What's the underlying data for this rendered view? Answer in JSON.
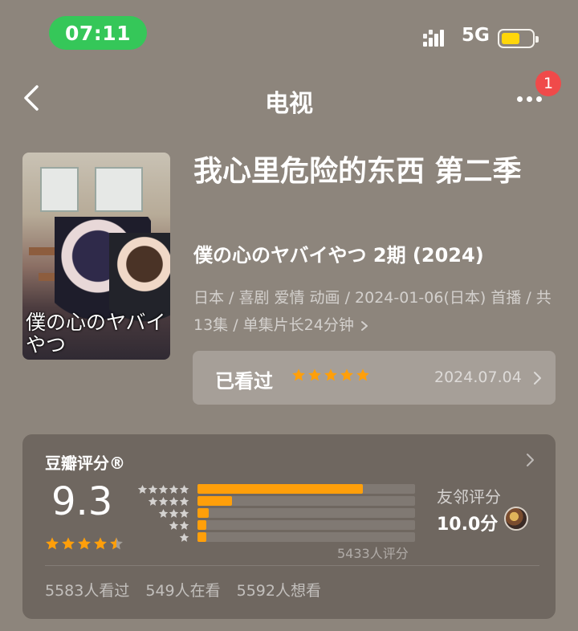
{
  "status_bar": {
    "time": "07:11",
    "network": "5G",
    "battery_level": 0.6,
    "signal_icon": "cellular-signal-icon",
    "battery_icon": "battery-icon"
  },
  "nav": {
    "title": "电视",
    "back_icon": "chevron-left-icon",
    "more_icon": "more-dots-icon",
    "badge_count": "1"
  },
  "poster": {
    "title_text": "僕の心のヤバイやつ"
  },
  "detail": {
    "title": "我心里危险的东西 第二季",
    "original_title": "僕の心のヤバイやつ 2期 (2024)",
    "meta": "日本 / 喜剧 爱情 动画 / 2024-01-06(日本) 首播 / 共13集 / 单集片长24分钟"
  },
  "watched": {
    "label": "已看过",
    "stars": 5,
    "date": "2024.07.04",
    "star_color": "#ff9f0a"
  },
  "rating": {
    "brand": "豆瓣评分®",
    "score": "9.3",
    "stars": 4.5,
    "distribution": [
      0.76,
      0.16,
      0.05,
      0.02,
      0.02
    ],
    "vote_count": "5433人评分",
    "friend_label": "友邻评分",
    "friend_score": "10.0分",
    "stats": {
      "watched": "5583人看过",
      "watching": "549人在看",
      "wish": "5592人想看"
    },
    "accent_color": "#ff9f0a"
  }
}
